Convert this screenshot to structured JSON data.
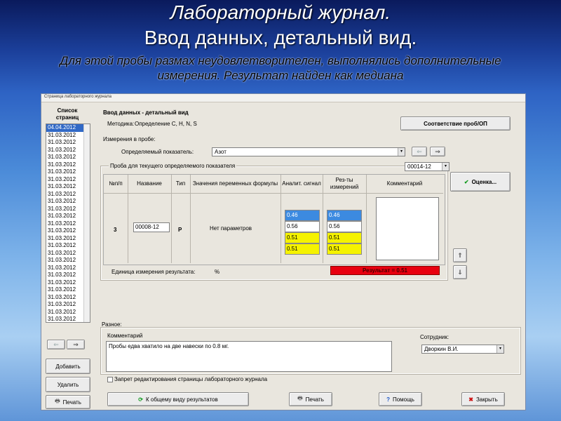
{
  "slide": {
    "title_line1": "Лабораторный журнал.",
    "title_line2": "Ввод данных, детальный вид.",
    "subtitle": "Для этой пробы размах неудовлетворителен, выполнялись дополнительные измерения. Результат найден как медиана"
  },
  "window": {
    "title": "Страница лабораторного журнала"
  },
  "pages": {
    "header": "Список страниц",
    "items": [
      "04.04.2012",
      "31.03.2012",
      "31.03.2012",
      "31.03.2012",
      "31.03.2012",
      "31.03.2012",
      "31.03.2012",
      "31.03.2012",
      "31.03.2012",
      "31.03.2012",
      "31.03.2012",
      "31.03.2012",
      "31.03.2012",
      "31.03.2012",
      "31.03.2012",
      "31.03.2012",
      "31.03.2012",
      "31.03.2012",
      "31.03.2012",
      "31.03.2012",
      "31.03.2012",
      "31.03.2012",
      "31.03.2012",
      "31.03.2012",
      "31.03.2012",
      "31.03.2012",
      "31.03.2012"
    ],
    "prev_icon": "arrow-left",
    "next_icon": "arrow-right",
    "add_label": "Добавить",
    "delete_label": "Удалить",
    "print_label": "Печать"
  },
  "detail": {
    "heading": "Ввод данных - детальный вид",
    "method_label": "Методика:",
    "method_value": "Определение C, H, N, S",
    "match_button": "Соответствие проб/ОП",
    "measurements_label": "Измерения в пробе:",
    "indicator_label": "Определяемый показатель:",
    "indicator_value": "Азот",
    "sample_group_label": "Проба для текущего определяемого показателя",
    "sample_select": "00014-12",
    "assess_button": "Оценка...",
    "columns": {
      "num": "№п/п",
      "name": "Название",
      "type": "Тип",
      "formula": "Значения переменных формулы",
      "signal": "Аналит. сигнал",
      "results": "Рез-ты измерений",
      "comment": "Комментарий"
    },
    "row": {
      "num": "3",
      "name": "00008-12",
      "type": "P",
      "formula": "Нет параметров",
      "signals": [
        "0.46",
        "0.56",
        "0.51",
        "0.51"
      ],
      "results": [
        "0.46",
        "0.56",
        "0.51",
        "0.51"
      ]
    },
    "unit_label": "Единица измерения результата:",
    "unit_value": "%",
    "result_text": "Результат = 0.51"
  },
  "misc": {
    "label": "Разное:",
    "comment_label": "Комментарий",
    "comment_text": "Пробы едва хватило на две навески по 0.8 мг.",
    "employee_label": "Сотрудник:",
    "employee_value": "Дворкин В.И.",
    "lock_label": "Запрет редактирования страницы лабораторного журнала"
  },
  "footer": {
    "overview_button": "К общему виду результатов",
    "print_button": "Печать",
    "help_button": "Помощь",
    "close_button": "Закрыть"
  },
  "colors": {
    "selected_blue": "#3169c6",
    "cell_blue": "#3c8ae0",
    "cell_yellow": "#f5f200",
    "result_red": "#e8000f"
  }
}
